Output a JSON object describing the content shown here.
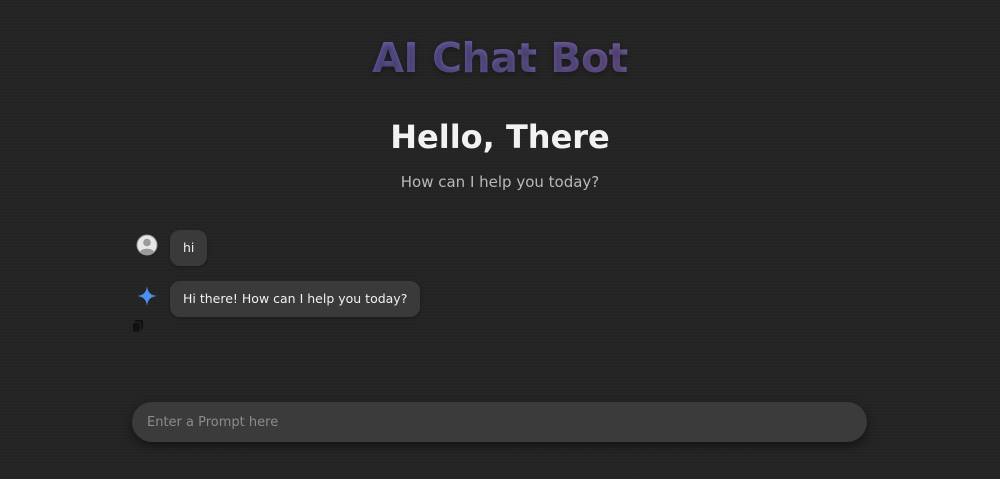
{
  "header": {
    "brand_title": "AI Chat Bot",
    "greeting": "Hello, There",
    "subgreeting": "How can I help you today?"
  },
  "chat": {
    "messages": [
      {
        "role": "user",
        "text": "hi",
        "avatar_icon": "user-avatar-icon"
      },
      {
        "role": "bot",
        "text": "Hi there! How can I help you today?",
        "avatar_icon": "sparkle-icon"
      }
    ],
    "copy_icon": "copy-icon"
  },
  "prompt": {
    "placeholder": "Enter a Prompt here",
    "value": ""
  },
  "colors": {
    "background": "#242424",
    "bubble": "#3a3a3a",
    "brand_gradient_start": "#5a66b8",
    "brand_gradient_end": "#8a5f8f",
    "sparkle": "#4f8ff0"
  }
}
